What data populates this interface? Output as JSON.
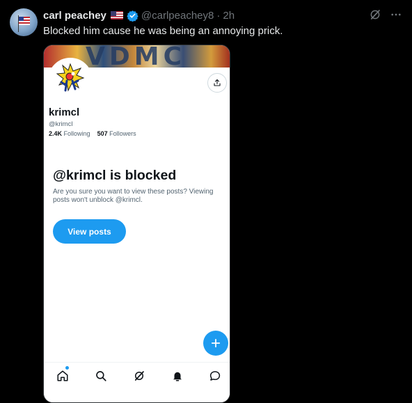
{
  "tweet": {
    "author_name": "carl peachey",
    "author_handle": "@carlpeachey8",
    "separator": "·",
    "time": "2h",
    "text": "Blocked him cause he was being an annoying prick."
  },
  "icons": {
    "header": [
      "flag-us-icon",
      "verified-badge-icon",
      "grok-icon",
      "more-icon"
    ],
    "media": [
      "share-icon",
      "compose-plus-icon",
      "home-icon",
      "search-icon",
      "grok-icon",
      "notifications-icon",
      "messages-icon"
    ]
  },
  "embedded_profile": {
    "banner_text": "VDMC",
    "display_name": "krimcl",
    "handle": "@krimcl",
    "following_count": "2.4K",
    "following_label": "Following",
    "followers_count": "507",
    "followers_label": "Followers",
    "blocked_title": "@krimcl is blocked",
    "blocked_description": "Are you sure you want to view these posts? Viewing posts won't unblock @krimcl.",
    "view_posts_label": "View posts"
  },
  "colors": {
    "background": "#000000",
    "accent": "#1d9bf0",
    "muted": "#71767b"
  }
}
